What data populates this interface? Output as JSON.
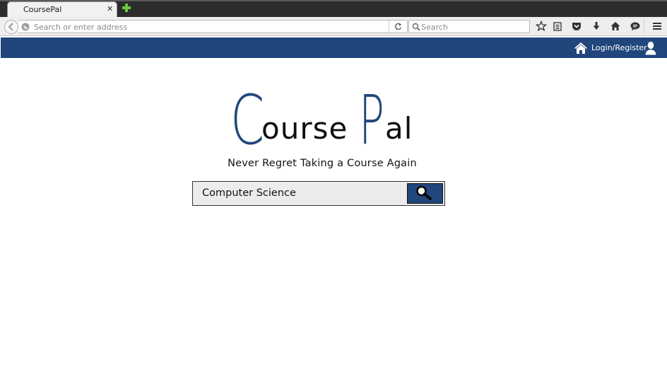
{
  "browser": {
    "tab_title": "CoursePal",
    "tab_close": "✕",
    "url_placeholder": "Search or enter address",
    "search_placeholder": "Search"
  },
  "header": {
    "login_label": "Login/Register",
    "bg_color": "#21467b"
  },
  "hero": {
    "logo_letter_1": "C",
    "logo_rest_1": "ourse",
    "logo_letter_2": "P",
    "logo_rest_2": "al",
    "tagline": "Never Regret Taking a Course Again",
    "search_value": "Computer Science",
    "accent_color": "#21467b"
  },
  "icons": {
    "toolbar": [
      "star-icon",
      "reading-list-icon",
      "pocket-icon",
      "download-icon",
      "home-icon",
      "chat-icon",
      "menu-icon"
    ],
    "header": [
      "home-icon",
      "user-icon"
    ],
    "search": "magnifier-icon"
  }
}
